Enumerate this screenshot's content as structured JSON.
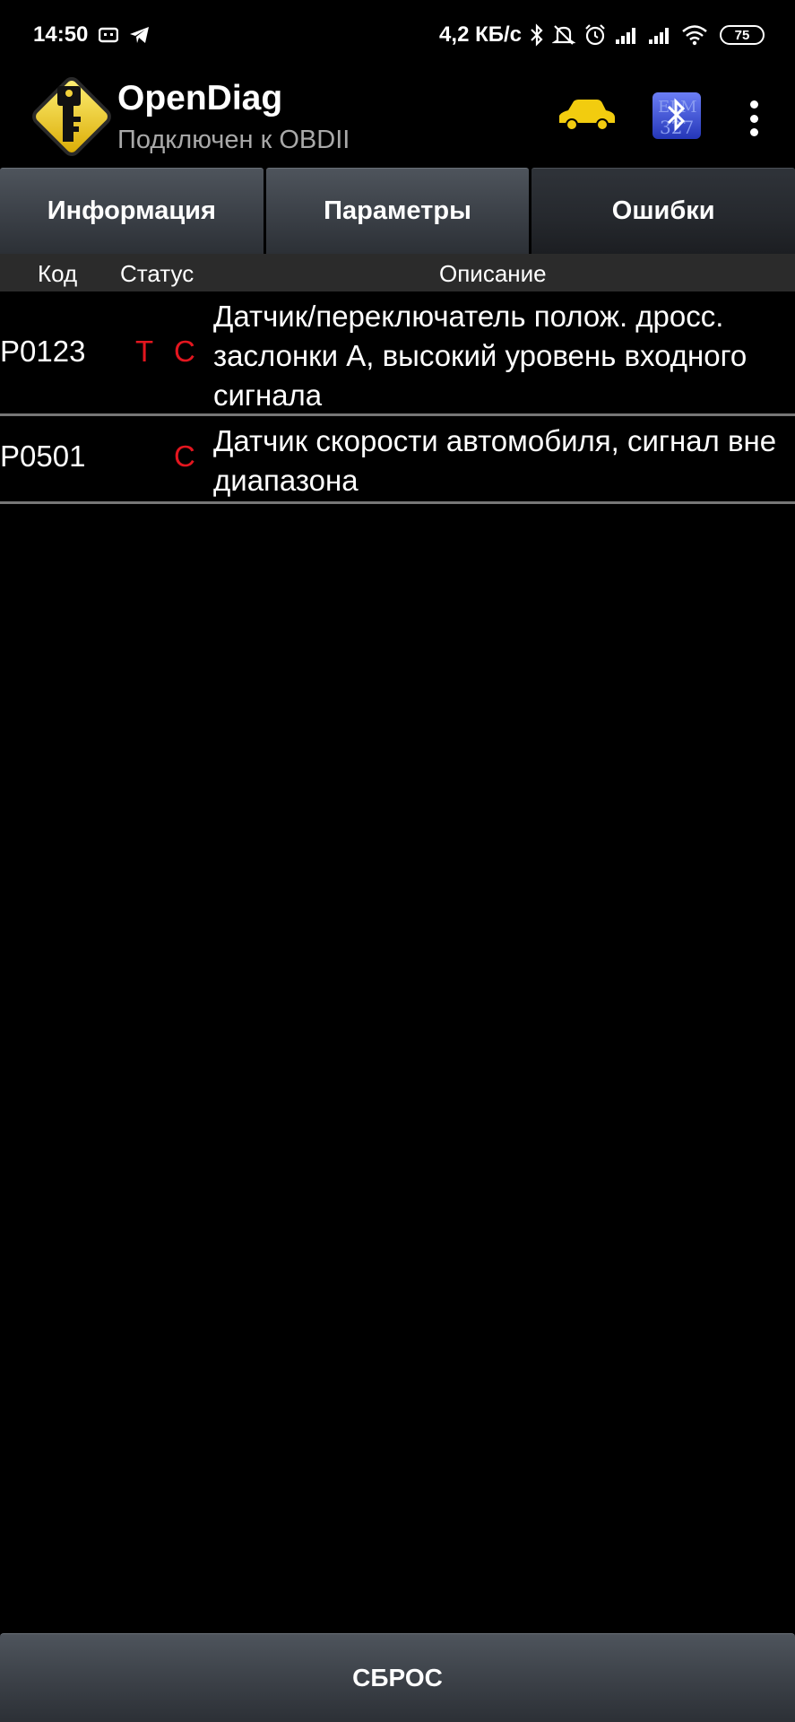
{
  "status_bar": {
    "time": "14:50",
    "net_speed": "4,2 КБ/с",
    "battery": "75",
    "icons_left": [
      "screen-record-icon",
      "telegram-icon"
    ],
    "icons_right": [
      "bluetooth-icon",
      "mute-icon",
      "alarm-icon",
      "signal-icon",
      "signal-icon",
      "wifi-icon"
    ]
  },
  "app_bar": {
    "title": "OpenDiag",
    "subtitle": "Подключен к OBDII",
    "car_color": "#f2cc0f"
  },
  "tabs": [
    {
      "label": "Информация",
      "selected": false
    },
    {
      "label": "Параметры",
      "selected": false
    },
    {
      "label": "Ошибки",
      "selected": true
    }
  ],
  "columns": {
    "code": "Код",
    "status": "Статус",
    "description": "Описание"
  },
  "errors": [
    {
      "code": "P0123",
      "status_t": "Т",
      "status_c": "С",
      "description": "Датчик/переключатель полож. дросс. заслонки А, высокий уровень входного сигнала"
    },
    {
      "code": "P0501",
      "status_t": "",
      "status_c": "С",
      "description": "Датчик скорости автомобиля, сигнал вне диапазона"
    }
  ],
  "reset_button": "СБРОС",
  "colors": {
    "status_red": "#e3161f",
    "background": "#000000"
  }
}
